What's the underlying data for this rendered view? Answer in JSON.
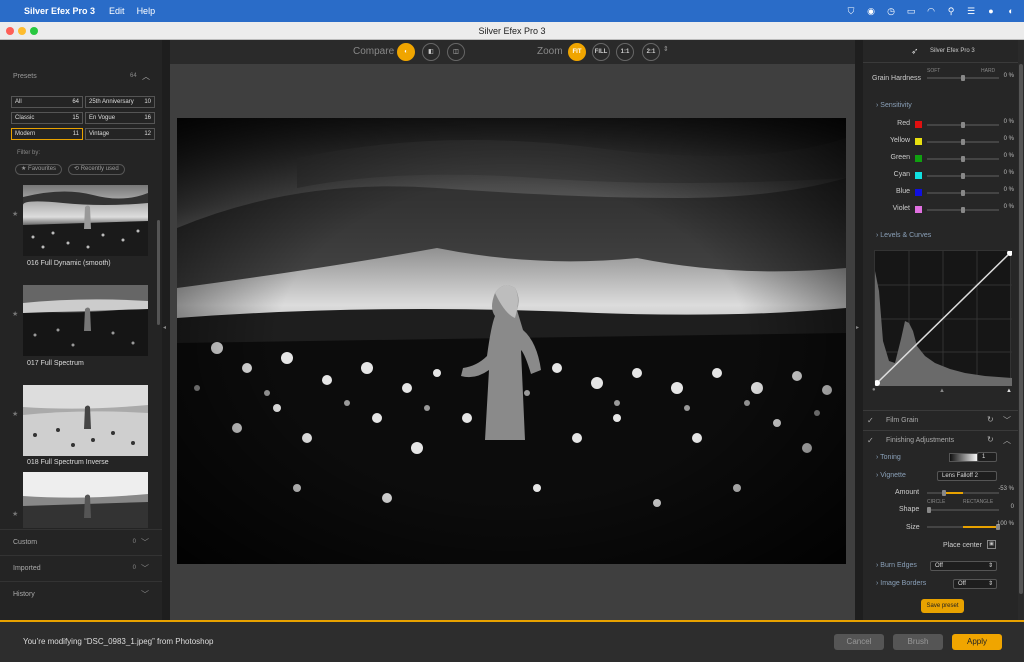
{
  "menubar": {
    "app": "Silver Efex Pro 3",
    "items": [
      "Edit",
      "Help"
    ]
  },
  "window": {
    "title": "Silver Efex Pro 3"
  },
  "toolbar": {
    "compare_label": "Compare",
    "zoom_label": "Zoom",
    "zoom_buttons": [
      "FIT",
      "FILL",
      "1:1",
      "2:1"
    ]
  },
  "presets": {
    "header": "Presets",
    "count": "64",
    "categories": [
      {
        "label": "All",
        "count": "64"
      },
      {
        "label": "25th Anniversary",
        "count": "10"
      },
      {
        "label": "Classic",
        "count": "15"
      },
      {
        "label": "En Vogue",
        "count": "16"
      },
      {
        "label": "Modern",
        "count": "11"
      },
      {
        "label": "Vintage",
        "count": "12"
      }
    ],
    "filter_label": "Filter by:",
    "filters": [
      "★ Favourites",
      "⟲ Recently used"
    ],
    "items": [
      "016 Full Dynamic (smooth)",
      "017 Full Spectrum",
      "018 Full Spectrum Inverse"
    ]
  },
  "left_sections": [
    {
      "label": "Custom",
      "count": "0"
    },
    {
      "label": "Imported",
      "count": "0"
    },
    {
      "label": "History",
      "count": ""
    }
  ],
  "right": {
    "logo": "Silver Efex Pro 3",
    "grain_hardness": {
      "label": "Grain Hardness",
      "soft": "SOFT",
      "hard": "HARD",
      "value": "0 %"
    },
    "sensitivity": {
      "header": "Sensitivity",
      "rows": [
        {
          "label": "Red",
          "value": "0 %",
          "color": "#e01010"
        },
        {
          "label": "Yellow",
          "value": "0 %",
          "color": "#e8e010"
        },
        {
          "label": "Green",
          "value": "0 %",
          "color": "#10a010"
        },
        {
          "label": "Cyan",
          "value": "0 %",
          "color": "#10e0e0"
        },
        {
          "label": "Blue",
          "value": "0 %",
          "color": "#1010e0"
        },
        {
          "label": "Violet",
          "value": "0 %",
          "color": "#e070e0"
        }
      ]
    },
    "levels_curves": "Levels & Curves",
    "film_grain": "Film Grain",
    "finishing": "Finishing Adjustments",
    "toning": {
      "label": "Toning",
      "value": "1"
    },
    "vignette": {
      "label": "Vignette",
      "preset": "Lens Falloff 2"
    },
    "amount": {
      "label": "Amount",
      "value": "-53 %",
      "level": -0.53
    },
    "shape": {
      "label": "Shape",
      "circle": "CIRCLE",
      "rectangle": "RECTANGLE",
      "value": "0"
    },
    "size": {
      "label": "Size",
      "value": "100 %",
      "level": 1.0
    },
    "place_center": "Place center",
    "burn_edges": {
      "label": "Burn Edges",
      "value": "Off"
    },
    "image_borders": {
      "label": "Image Borders",
      "value": "Off"
    },
    "save_preset": "Save preset"
  },
  "bottom": {
    "status": "You’re modifying “DSC_0983_1.jpeg” from Photoshop",
    "cancel": "Cancel",
    "brush": "Brush",
    "apply": "Apply"
  },
  "colors": {
    "accent": "#f0a500",
    "menubar": "#2a6cc8"
  }
}
